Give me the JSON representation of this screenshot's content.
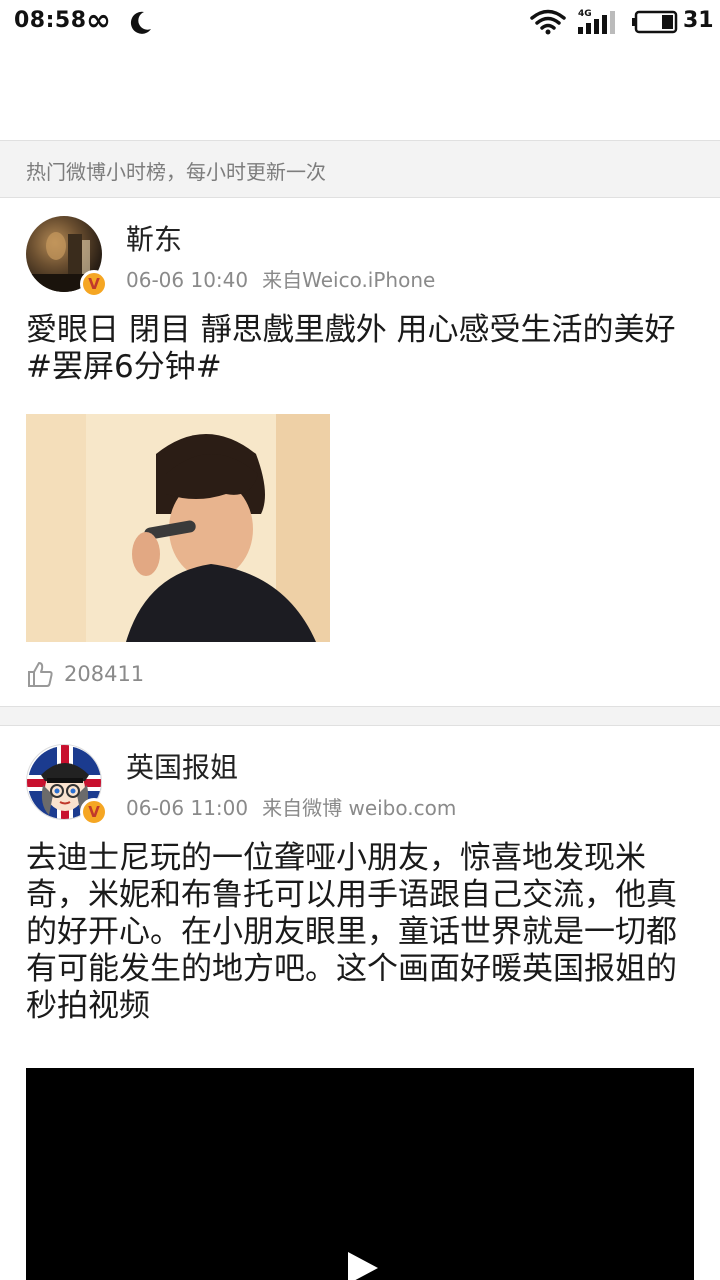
{
  "status_bar": {
    "time": "08:58",
    "infinity_icon": "∞",
    "battery_level": "31",
    "signal_label": "4G"
  },
  "notice": {
    "text": "热门微博小时榜，每小时更新一次"
  },
  "posts": [
    {
      "author": "靳东",
      "time": "06-06 10:40",
      "source": "来自Weico.iPhone",
      "text": "愛眼日 閉目 靜思戲里戲外 用心感受生活的美好 #罢屏6分钟#",
      "likes": "208411",
      "verified_badge": "V"
    },
    {
      "author": "英国报姐",
      "time": "06-06 11:00",
      "source": "来自微博 weibo.com",
      "text": "去迪士尼玩的一位聋哑小朋友，惊喜地发现米奇，米妮和布鲁托可以用手语跟自己交流，他真的好开心。在小朋友眼里，童话世界就是一切都有可能发生的地方吧。这个画面好暖英国报姐的秒拍视频",
      "verified_badge": "V"
    }
  ],
  "colors": {
    "verified_badge": "#f5a623",
    "meta_text": "#8a8a8a",
    "notice_bg": "#f3f3f3"
  },
  "icons": [
    "infinity-icon",
    "moon-icon",
    "wifi-icon",
    "signal-icon",
    "battery-icon",
    "verified-icon",
    "like-icon",
    "play-icon"
  ]
}
